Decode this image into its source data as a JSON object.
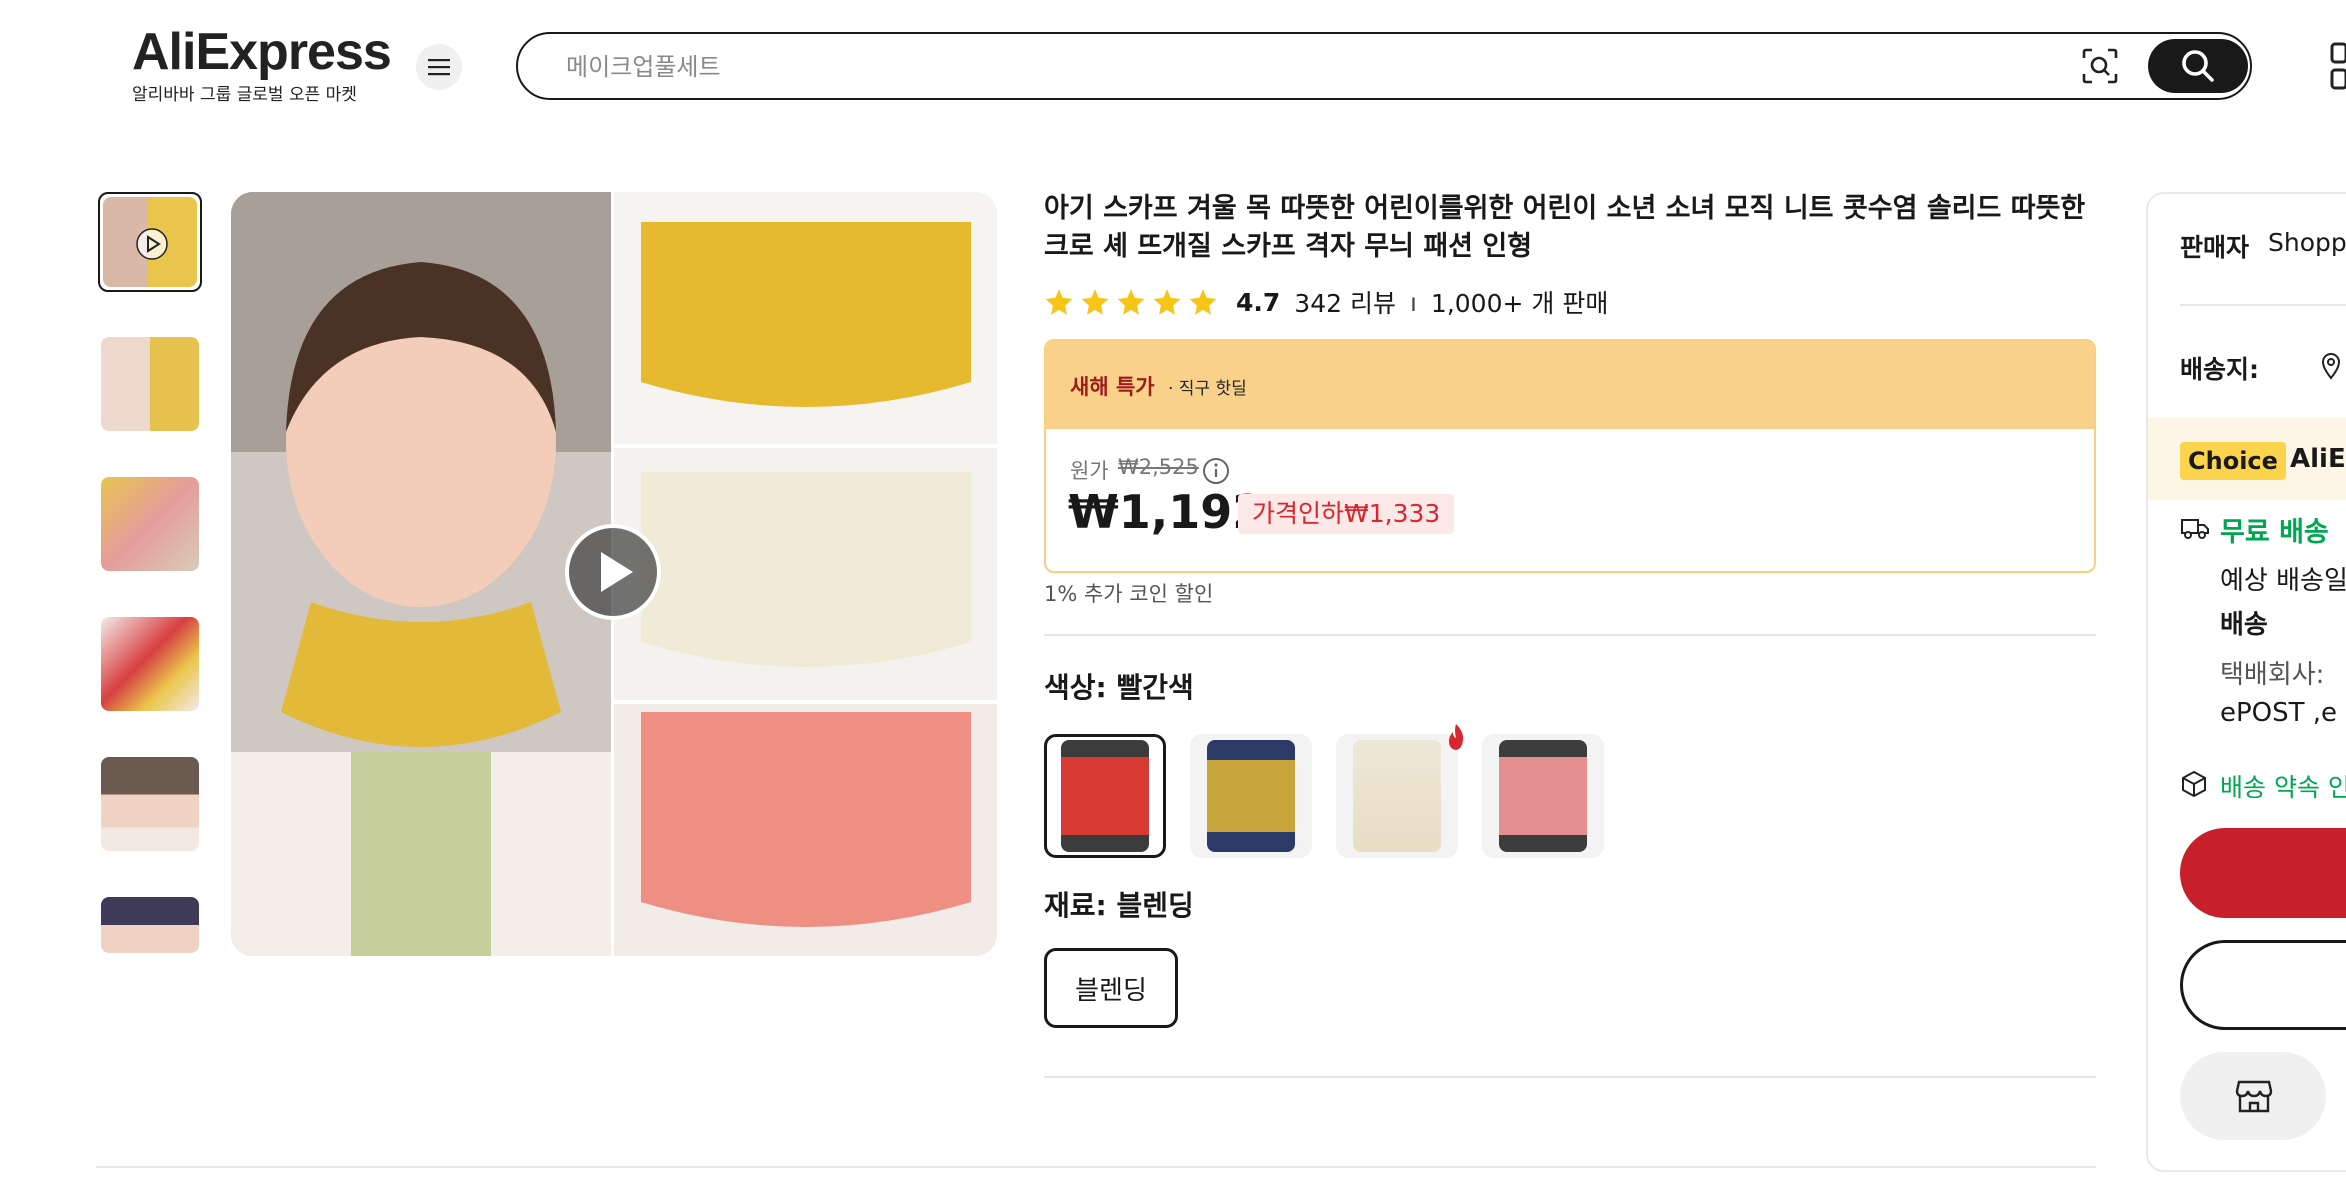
{
  "header": {
    "logo": "AliExpress",
    "logo_sub": "알리바바 그룹 글로벌 오픈 마켓",
    "search_placeholder": "메이크업풀세트"
  },
  "product": {
    "title": "아기 스카프 겨울 목 따뜻한 어린이를위한 어린이 소년 소녀 모직 니트 콧수염 솔리드 따뜻한 크로 셰 뜨개질 스카프 격자 무늬 패션 인형",
    "rating": "4.7",
    "reviews": "342 리뷰",
    "separator": "ı",
    "sold": "1,000+ 개 판매",
    "stars": 5
  },
  "deal": {
    "badge": "새해 특가",
    "badge_sub": "· 직구 핫딜",
    "original_label": "원가",
    "original_price": "₩2,525",
    "price": "₩1,192",
    "discount": "가격인하₩1,333",
    "coin": "1% 추가 코인 할인"
  },
  "options": {
    "color_label": "색상: 빨간색",
    "material_label": "재료: 블렌딩",
    "material_value": "블렌딩",
    "colors": [
      {
        "name": "red",
        "color": "#d63a32"
      },
      {
        "name": "yellow",
        "color": "#c9a43a"
      },
      {
        "name": "beige",
        "color": "#efe7d6"
      },
      {
        "name": "pink",
        "color": "#e48f8f"
      }
    ]
  },
  "side_panel": {
    "seller_label": "판매자",
    "seller_name": "Shopp",
    "ship_to_label": "배송지:",
    "choice_badge": "Choice",
    "choice_text": "AliE",
    "free_shipping": "무료 배송",
    "delivery_est": "예상 배송일",
    "delivery_word": "배송",
    "courier_label": "택배회사:",
    "courier_value": "ePOST ,e",
    "promise": "배송 약속 인"
  },
  "colors": {
    "accent_red": "#c7202a",
    "green": "#00a651",
    "deal_yellow": "#fad18a",
    "text": "#191919"
  }
}
